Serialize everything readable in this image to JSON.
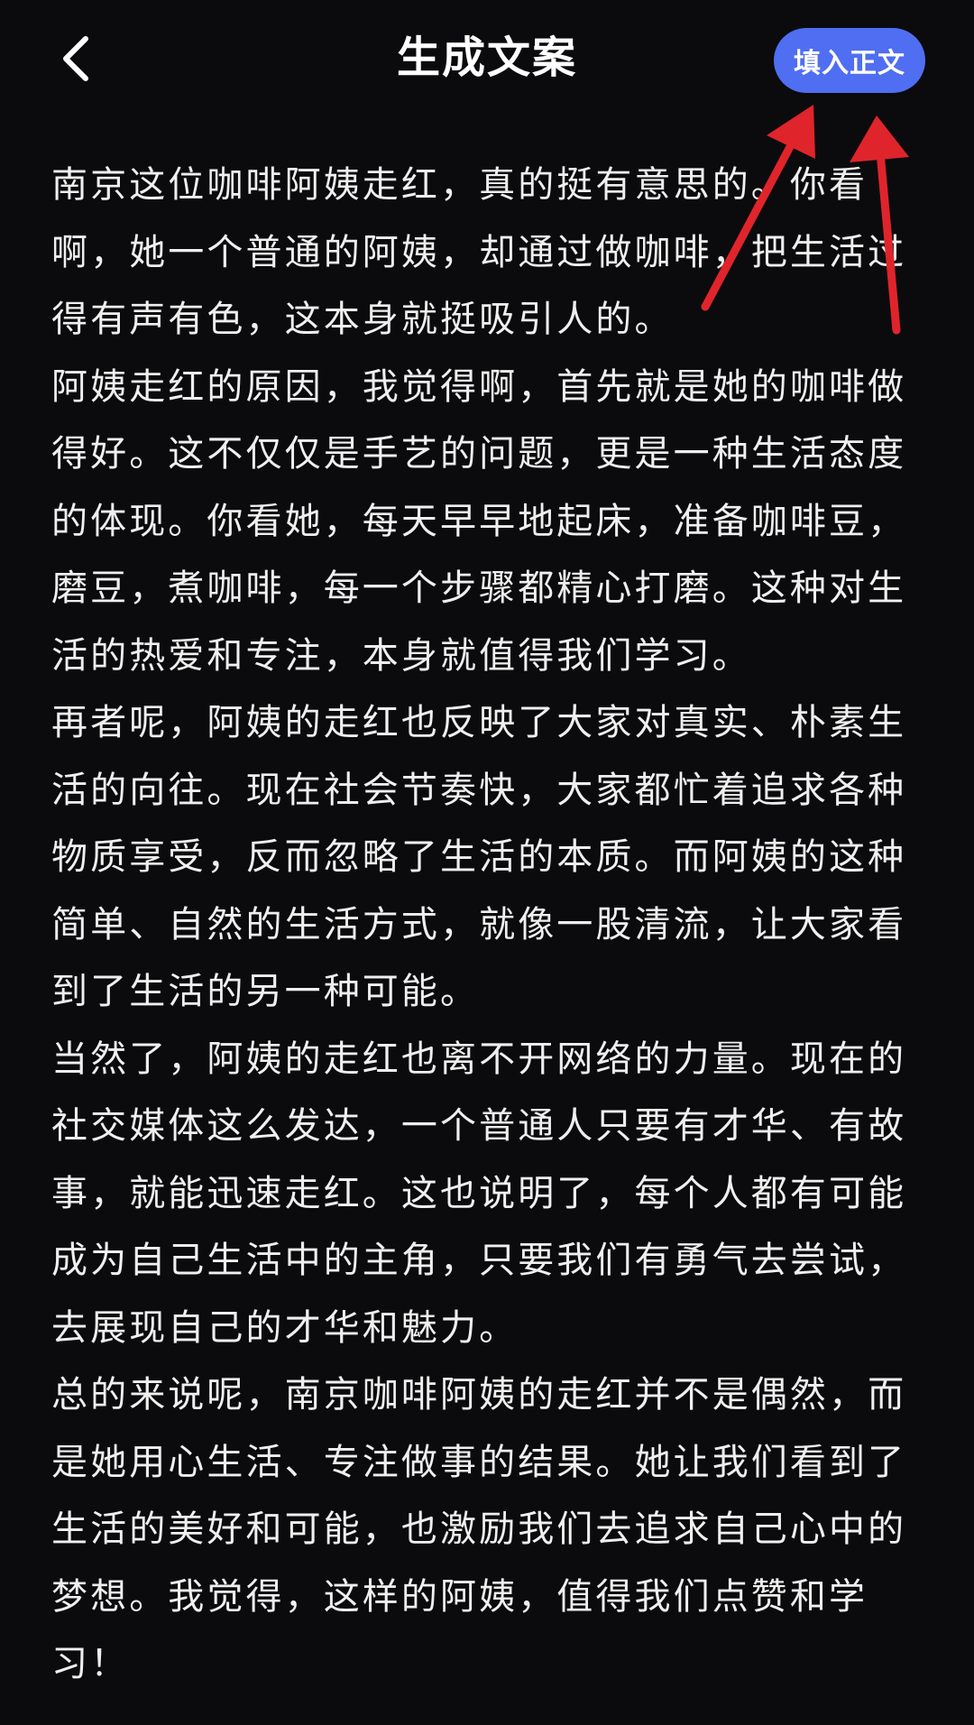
{
  "header": {
    "title": "生成文案",
    "back_icon": "chevron-left-icon",
    "fill_button_label": "填入正文"
  },
  "content": {
    "paragraphs": [
      "南京这位咖啡阿姨走红，真的挺有意思的。你看啊，她一个普通的阿姨，却通过做咖啡，把生活过得有声有色，这本身就挺吸引人的。",
      "阿姨走红的原因，我觉得啊，首先就是她的咖啡做得好。这不仅仅是手艺的问题，更是一种生活态度的体现。你看她，每天早早地起床，准备咖啡豆，磨豆，煮咖啡，每一个步骤都精心打磨。这种对生活的热爱和专注，本身就值得我们学习。",
      "再者呢，阿姨的走红也反映了大家对真实、朴素生活的向往。现在社会节奏快，大家都忙着追求各种物质享受，反而忽略了生活的本质。而阿姨的这种简单、自然的生活方式，就像一股清流，让大家看到了生活的另一种可能。",
      "当然了，阿姨的走红也离不开网络的力量。现在的社交媒体这么发达，一个普通人只要有才华、有故事，就能迅速走红。这也说明了，每个人都有可能成为自己生活中的主角，只要我们有勇气去尝试，去展现自己的才华和魅力。",
      "总的来说呢，南京咖啡阿姨的走红并不是偶然，而是她用心生活、专注做事的结果。她让我们看到了生活的美好和可能，也激励我们去追求自己心中的梦想。我觉得，这样的阿姨，值得我们点赞和学习！"
    ]
  },
  "annotation": {
    "icon": "red-arrow-icon",
    "color": "#e0242b"
  },
  "colors": {
    "background": "#0b0b0d",
    "accent": "#4f6ef2",
    "text": "#efefef"
  }
}
